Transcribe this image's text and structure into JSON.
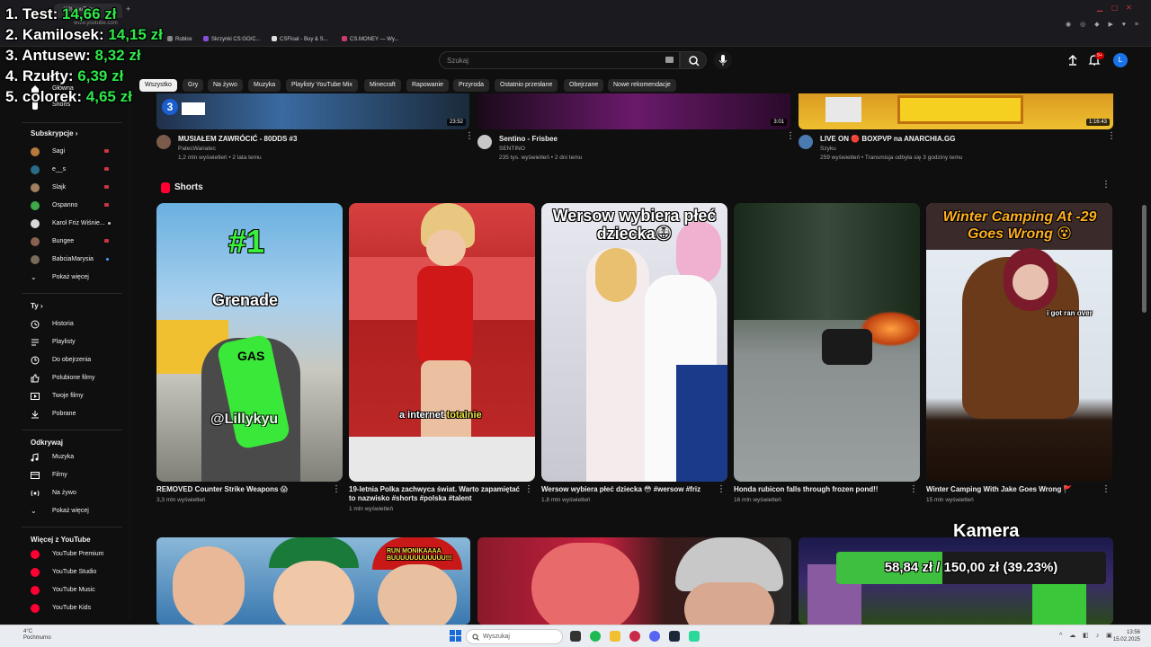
{
  "leaderboard": [
    {
      "rank_name": "1. Test:",
      "amount": "14,66 zł"
    },
    {
      "rank_name": "2. Kamilosek:",
      "amount": "14,15 zł"
    },
    {
      "rank_name": "3. Antusew:",
      "amount": "8,32 zł"
    },
    {
      "rank_name": "4. Rzułty:",
      "amount": "6,39 zł"
    },
    {
      "rank_name": "5. colorek:",
      "amount": "4,65 zł"
    }
  ],
  "browser": {
    "tab_title": "(99) YouTube",
    "url": "www.youtube.com",
    "bookmarks": [
      "Roblox",
      "Skrzynki CS:GO/C...",
      "CSFloat - Buy & S...",
      "CS.MONEY — Wy..."
    ]
  },
  "header": {
    "search_placeholder": "Szukaj",
    "notif_count": "9+",
    "avatar_letter": "L"
  },
  "chips": [
    "Wszystko",
    "Gry",
    "Na żywo",
    "Muzyka",
    "Playlisty YouTube Mix",
    "Minecraft",
    "Rapowanie",
    "Przyroda",
    "Ostatnio przesłane",
    "Obejrzane",
    "Nowe rekomendacje"
  ],
  "sidebar": {
    "top_items": [
      "Główna",
      "Shorts"
    ],
    "subscriptions_title": "Subskrypcje",
    "subscriptions": [
      {
        "name": "Sagi",
        "live": true
      },
      {
        "name": "e__s",
        "live": true
      },
      {
        "name": "Slajk",
        "live": true
      },
      {
        "name": "Ospanno",
        "live": true
      },
      {
        "name": "Karol Friz Wiśnie...",
        "dot": true
      },
      {
        "name": "Bungee",
        "live": true
      },
      {
        "name": "BabciaMarysia",
        "dot": true
      }
    ],
    "show_more": "Pokaż więcej",
    "you_title": "Ty",
    "you_items": [
      "Historia",
      "Playlisty",
      "Do obejrzenia",
      "Polubione filmy",
      "Twoje filmy",
      "Pobrane"
    ],
    "explore_title": "Odkrywaj",
    "explore_items": [
      "Muzyka",
      "Filmy",
      "Na żywo",
      "Pokaż więcej"
    ],
    "more_title": "Więcej z YouTube",
    "more_items": [
      "YouTube Premium",
      "YouTube Studio",
      "YouTube Music",
      "YouTube Kids"
    ]
  },
  "top_videos": [
    {
      "title": "MUSIAŁEM ZAWRÓCIĆ - 80DDS #3",
      "channel": "PatecWariatec",
      "meta": "1,2 mln wyświetleń • 2 lata temu",
      "duration": "23:52",
      "badge": "3"
    },
    {
      "title": "Sentino - Frisbee",
      "channel": "SENTINO",
      "meta": "235 tys. wyświetleń • 2 dni temu",
      "duration": "3:01"
    },
    {
      "title": "LIVE ON 🔴 BOXPVP na ANARCHIA.GG",
      "channel": "Szyku",
      "meta": "259 wyświetleń • Transmisja odbyła się 3 godziny temu",
      "duration": "1:16:43"
    }
  ],
  "shorts": {
    "title": "Shorts",
    "items": [
      {
        "title": "REMOVED Counter Strike Weapons 😱",
        "meta": "3,3 mln wyświetleń",
        "overlay_top": "#1",
        "overlay_mid": "Grenade",
        "overlay_bottom": "@Lillykyu",
        "label": "GAS"
      },
      {
        "title": "19-letnia Polka zachwyca świat. Warto zapamiętać to nazwisko #shorts #polska #talent",
        "meta": "1 mln wyświetleń",
        "overlay_mid": "a internet",
        "overlay_accent": "totalnie"
      },
      {
        "title": "Wersow wybiera płeć dziecka 😳 #wersow #friz",
        "meta": "1,8 mln wyświetleń",
        "overlay_top": "Wersow wybiera płeć dziecka😳"
      },
      {
        "title": "Honda rubicon falls through frozen pond!!",
        "meta": "16 mln wyświetleń"
      },
      {
        "title": "Winter Camping With Jake Goes Wrong 🚩",
        "meta": "15 mln wyświetleń",
        "overlay_top": "Winter Camping At -29 Goes Wrong 😵",
        "overlay_mid": "i got ran over"
      }
    ]
  },
  "bottom": {
    "run_text": "RUN MONIKAAAA BUUUUUUUUUUUU!!!",
    "kamera": "Kamera",
    "goal_text": "58,84 zł / 150,00 zł (39.23%)",
    "goal_fraction": 0.3923
  },
  "taskbar": {
    "weather": "4°C",
    "weather_desc": "Pochmurno",
    "search": "Wyszukaj",
    "time": "13:56",
    "date": "15.02.2025"
  },
  "colors": {
    "bg": "#0f0f0f",
    "accent_green": "#2ee84a",
    "yt_red": "#ff0033"
  }
}
